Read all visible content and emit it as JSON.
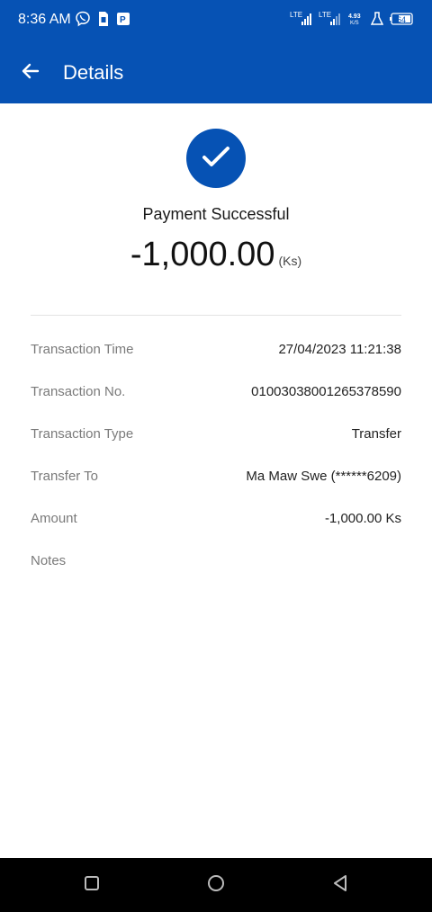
{
  "status_bar": {
    "time": "8:36 AM",
    "network_1": "LTE",
    "network_2": "LTE",
    "speed_value": "4.93",
    "speed_unit": "K/S",
    "battery": "64"
  },
  "app_bar": {
    "title": "Details",
    "back_icon": "arrow-left-icon"
  },
  "result": {
    "status_text": "Payment Successful",
    "amount": "-1,000.00",
    "currency": "(Ks)",
    "icon": "check-icon"
  },
  "details": [
    {
      "label": "Transaction Time",
      "value": "27/04/2023 11:21:38"
    },
    {
      "label": "Transaction No.",
      "value": "01003038001265378590"
    },
    {
      "label": "Transaction Type",
      "value": "Transfer"
    },
    {
      "label": "Transfer To",
      "value": "Ma Maw Swe (******6209)"
    },
    {
      "label": "Amount",
      "value": "-1,000.00 Ks"
    },
    {
      "label": "Notes",
      "value": ""
    }
  ],
  "colors": {
    "primary": "#0652b4",
    "background": "#ffffff",
    "label": "#7a7a7a",
    "value": "#222222"
  },
  "nav_bar": {
    "recents_icon": "square-icon",
    "home_icon": "circle-icon",
    "back_icon": "triangle-back-icon"
  }
}
